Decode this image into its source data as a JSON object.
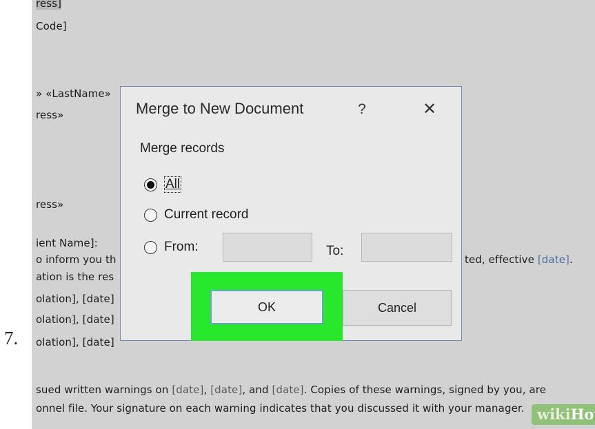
{
  "step": {
    "number": "7."
  },
  "document": {
    "lines": [
      {
        "text": "ress]"
      },
      {
        "text": " Code]"
      },
      {
        "text": "» «LastName»"
      },
      {
        "text": "ress»"
      },
      {
        "text": "ress»"
      },
      {
        "text": "ient Name]:"
      },
      {
        "text": "o inform you th",
        "tail": "ted, effective ",
        "tail_field": "[date]",
        "tail_end": "."
      },
      {
        "text": "ation is the res"
      },
      {
        "text": "olation], ",
        "field": "[date]"
      },
      {
        "text": "olation], ",
        "field": "[date]"
      },
      {
        "text": "olation], ",
        "field": "[date]"
      },
      {
        "text": "sued written warnings on ",
        "f1": "[date]",
        "s1": ", ",
        "f2": "[date]",
        "s2": ", and ",
        "f3": "[date]",
        "s3": ". Copies of these warnings, signed by you, are"
      },
      {
        "text": "onnel file. Your signature on each warning indicates that you discussed it with your manager."
      }
    ]
  },
  "dialog": {
    "title": "Merge to New Document",
    "help_label": "?",
    "close_label": "✕",
    "group_label": "Merge records",
    "options": {
      "all": {
        "label": "All",
        "selected": true
      },
      "current": {
        "label": "Current record",
        "selected": false
      },
      "from": {
        "label": "From:",
        "value": "",
        "selected": false
      }
    },
    "to": {
      "label": "To:",
      "value": ""
    },
    "ok_label": "OK",
    "cancel_label": "Cancel",
    "highlight_color": "#27e82b"
  },
  "watermark": {
    "part1": "wiki",
    "part2": "How"
  }
}
